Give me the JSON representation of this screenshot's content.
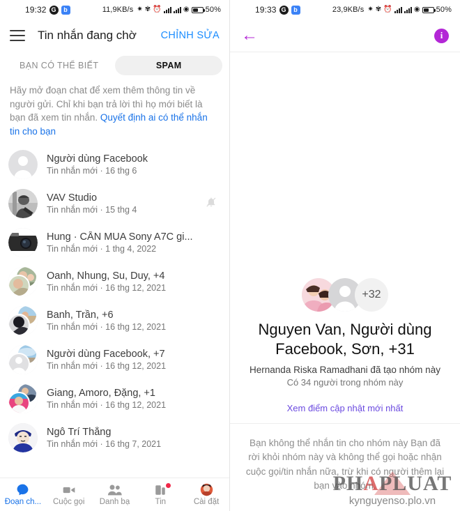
{
  "left": {
    "status": {
      "time": "19:32",
      "badge1": "G",
      "badge2": "b",
      "speed": "11,9KB/s",
      "battery": "50%"
    },
    "header": {
      "title": "Tin nhắn đang chờ",
      "action": "CHỈNH SỬA",
      "menu_icon": "hamburger-icon"
    },
    "tabs": [
      {
        "label": "BẠN CÓ THỂ BIẾT",
        "active": false
      },
      {
        "label": "SPAM",
        "active": true
      }
    ],
    "notice": {
      "text": "Hãy mở đoạn chat để xem thêm thông tin về người gửi. Chỉ khi bạn trả lời thì họ mới biết là bạn đã xem tin nhắn. ",
      "link": "Quyết định ai có thể nhắn tin cho bạn"
    },
    "rows": [
      {
        "name": "Người dùng Facebook",
        "sub": "Tin nhắn mới · 16 thg 6",
        "avatar": "placeholder",
        "muted": false
      },
      {
        "name": "VAV Studio",
        "sub": "Tin nhắn mới · 15 thg 4",
        "avatar": "photo-person-bw",
        "muted": true
      },
      {
        "name": "Hung · CẦN MUA Sony A7C gi...",
        "sub": "Tin nhắn mới · 1 thg 4, 2022",
        "avatar": "photo-camera",
        "muted": false
      },
      {
        "name": "Oanh, Nhung, Su, Duy, +4",
        "sub": "Tin nhắn mới · 16 thg 12, 2021",
        "avatar": "photo-group",
        "muted": false
      },
      {
        "name": "Banh, Trần, +6",
        "sub": "Tin nhắn mới · 16 thg 12, 2021",
        "avatar": "photo-group2",
        "muted": false
      },
      {
        "name": "Người dùng Facebook, +7",
        "sub": "Tin nhắn mới · 16 thg 12, 2021",
        "avatar": "photo-group3",
        "muted": false
      },
      {
        "name": "Giang, Amoro, Đặng, +1",
        "sub": "Tin nhắn mới · 16 thg 12, 2021",
        "avatar": "photo-group4",
        "muted": false
      },
      {
        "name": "Ngô Trí Thắng",
        "sub": "Tin nhắn mới · 16 thg 7, 2021",
        "avatar": "photo-cartoon",
        "muted": false
      }
    ],
    "bottom_nav": [
      {
        "label": "Đoạn ch...",
        "icon": "chat-bubble-icon",
        "active": true,
        "badge": false
      },
      {
        "label": "Cuộc gọi",
        "icon": "video-camera-icon",
        "active": false,
        "badge": false
      },
      {
        "label": "Danh bạ",
        "icon": "people-icon",
        "active": false,
        "badge": false
      },
      {
        "label": "Tin",
        "icon": "stories-icon",
        "active": false,
        "badge": true
      },
      {
        "label": "Cài đặt",
        "icon": "avatar-icon",
        "active": false,
        "badge": false
      }
    ]
  },
  "right": {
    "status": {
      "time": "19:33",
      "badge1": "G",
      "badge2": "b",
      "speed": "23,9KB/s",
      "battery": "50%"
    },
    "header": {
      "back_icon": "back-arrow-icon",
      "info_icon": "info-icon",
      "info_glyph": "i"
    },
    "group": {
      "overflow_count": "+32",
      "title": "Nguyen Van, Người dùng Facebook, Sơn, +31",
      "created_by": "Hernanda Riska Ramadhani đã tạo nhóm này",
      "member_count": "Có 34 người trong nhóm này",
      "link": "Xem điểm cập nhật mới nhất",
      "notice": "Bạn không thể nhắn tin cho nhóm này Bạn đã rời khỏi nhóm này và không thể gọi hoặc nhận cuộc gọi/tin nhắn nữa, trừ khi có người thêm lại bạn vào nhóm."
    },
    "watermark": {
      "main_left": "PH",
      "main_mid": "A",
      "main_right": "PLUAT",
      "sub": "kynguyenso.plo.vn"
    }
  },
  "colors": {
    "accent_blue": "#1a73e8",
    "link_blue": "#1a8cff",
    "purple": "#b327d6",
    "link_purple": "#6b4ae0",
    "badge_red": "#f02849"
  }
}
